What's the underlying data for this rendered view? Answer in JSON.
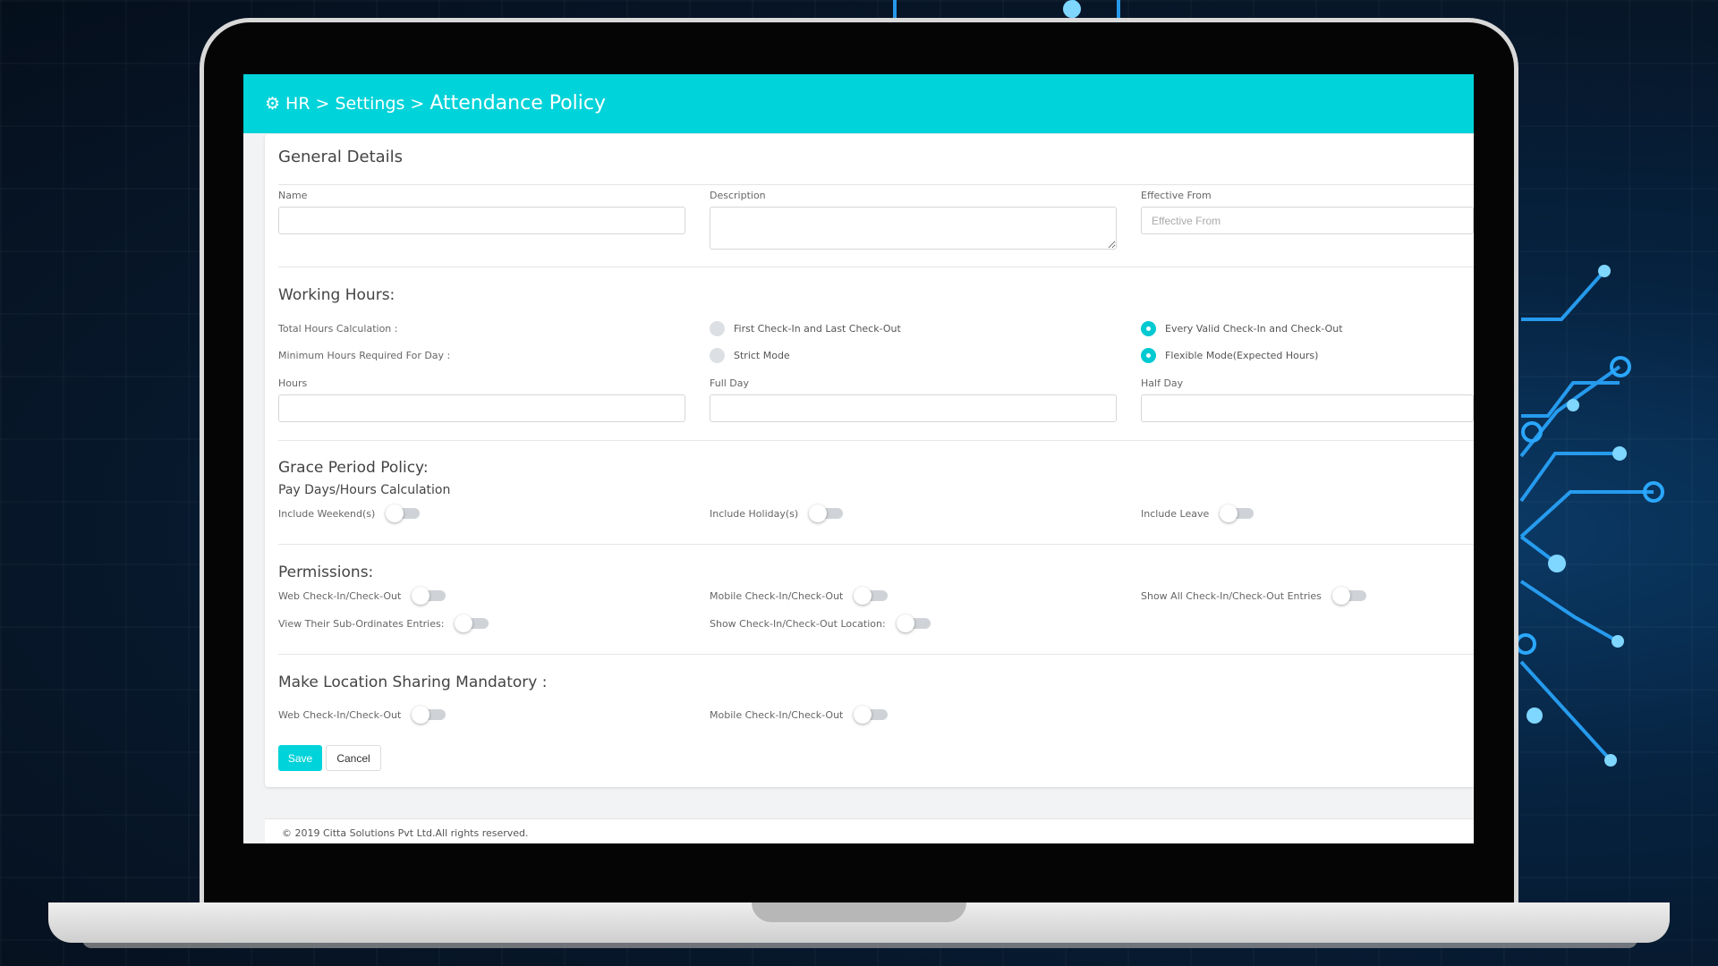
{
  "breadcrumb": {
    "icon": "gear-icon",
    "items": [
      "HR",
      "Settings"
    ],
    "separator": ">",
    "current": "Attendance Policy"
  },
  "general": {
    "title": "General Details",
    "name_label": "Name",
    "name_value": "",
    "description_label": "Description",
    "description_value": "",
    "effective_label": "Effective From",
    "effective_placeholder": "Effective From"
  },
  "working_hours": {
    "title": "Working Hours:",
    "total_label": "Total Hours Calculation :",
    "minimum_label": "Minimum Hours Required For Day :",
    "options_total": [
      {
        "label": "First Check-In and Last Check-Out",
        "selected": false
      },
      {
        "label": "Every Valid Check-In and Check-Out",
        "selected": true
      }
    ],
    "options_minimum": [
      {
        "label": "Strict Mode",
        "selected": false
      },
      {
        "label": "Flexible Mode(Expected Hours)",
        "selected": true
      }
    ],
    "hours_label": "Hours",
    "full_day_label": "Full Day",
    "half_day_label": "Half Day"
  },
  "grace": {
    "title": "Grace Period Policy:",
    "subtitle": "Pay Days/Hours Calculation",
    "include_weekends": "Include Weekend(s)",
    "include_holidays": "Include Holiday(s)",
    "include_leave": "Include Leave"
  },
  "permissions": {
    "title": "Permissions:",
    "web": "Web Check-In/Check-Out",
    "mobile": "Mobile Check-In/Check-Out",
    "show_all": "Show All Check-In/Check-Out Entries",
    "view_sub": "View Their Sub-Ordinates Entries:",
    "show_location": "Show Check-In/Check-Out Location:"
  },
  "location": {
    "title": "Make Location Sharing Mandatory :",
    "web": "Web Check-In/Check-Out",
    "mobile": "Mobile Check-In/Check-Out"
  },
  "buttons": {
    "save": "Save",
    "cancel": "Cancel"
  },
  "footer": {
    "text": "© 2019 Citta Solutions Pvt Ltd.All rights reserved."
  },
  "colors": {
    "accent": "#00d3d9",
    "toggle_off": "#cfd3d7"
  }
}
